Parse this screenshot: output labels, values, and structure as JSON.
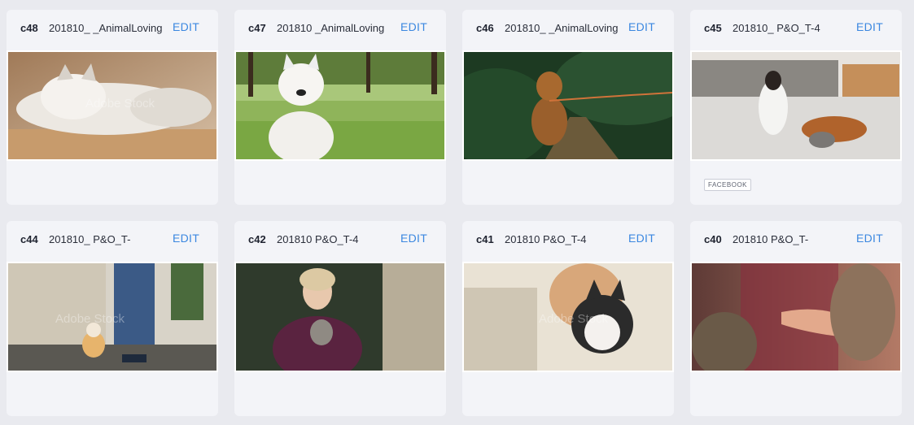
{
  "edit_label": "EDIT",
  "cards": [
    {
      "id": "c48",
      "name": "201810_ _AnimalLoving",
      "tag": ""
    },
    {
      "id": "c47",
      "name": "201810 _AnimalLoving",
      "tag": ""
    },
    {
      "id": "c46",
      "name": "201810_ _AnimalLoving",
      "tag": ""
    },
    {
      "id": "c45",
      "name": "201810_ P&O_T-4",
      "tag": "FACEBOOK"
    },
    {
      "id": "c44",
      "name": "201810_ P&O_T-",
      "tag": ""
    },
    {
      "id": "c42",
      "name": "201810 P&O_T-4",
      "tag": ""
    },
    {
      "id": "c41",
      "name": "201810 P&O_T-4",
      "tag": ""
    },
    {
      "id": "c40",
      "name": "201810 P&O_T-",
      "tag": ""
    }
  ],
  "watermark": "Adobe Stock"
}
